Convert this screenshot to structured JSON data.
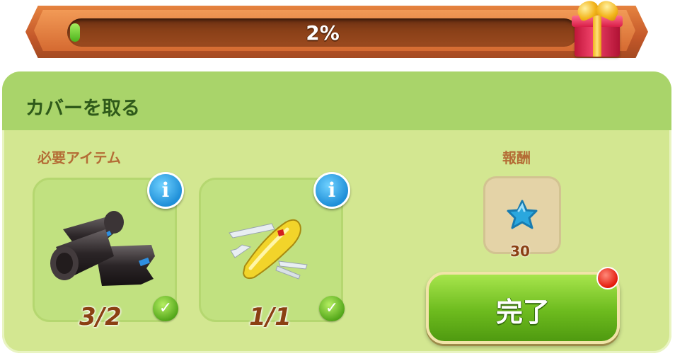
{
  "progress": {
    "percent_label": "2%",
    "fraction": 0.02
  },
  "quest": {
    "title": "カバーを取る",
    "required_items_label": "必要アイテム",
    "reward_label": "報酬",
    "items": [
      {
        "name": "plastic-bag-roll",
        "count": "3/2",
        "complete": true
      },
      {
        "name": "pocket-knife",
        "count": "1/1",
        "complete": true
      }
    ],
    "reward": {
      "icon": "blue-star-cookie-icon",
      "amount": "30"
    },
    "complete_button": "完了"
  },
  "icons": {
    "info": "i",
    "check": "✓"
  },
  "colors": {
    "progress_fill": "#4bb21d",
    "info_button": "#1f8fd8",
    "complete_button": "#6dbb1e",
    "notify_dot": "#e3190b"
  }
}
